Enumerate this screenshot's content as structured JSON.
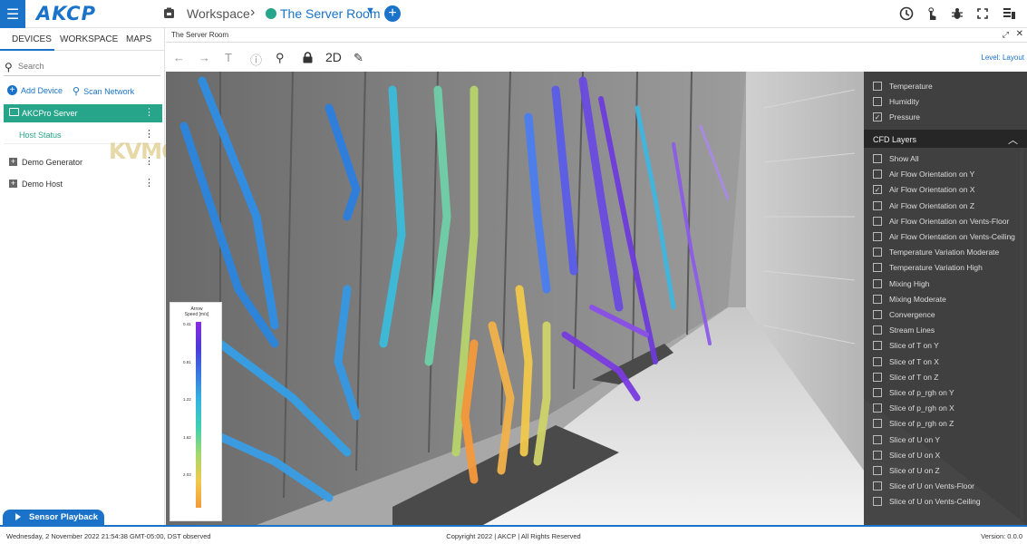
{
  "app": {
    "logo": "AKCP"
  },
  "breadcrumb": {
    "workspace": "Workspace",
    "room": "The Server Room"
  },
  "sidebar": {
    "tabs": [
      "DEVICES",
      "WORKSPACE",
      "MAPS"
    ],
    "search_placeholder": "Search",
    "actions": {
      "add_device": "Add Device",
      "scan_network": "Scan Network"
    },
    "server": "AKCPro Server",
    "host_status": "Host Status",
    "devices": [
      "Demo Generator",
      "Demo Host"
    ],
    "watermark": "KVMGalore"
  },
  "panel": {
    "title": "The Server Room",
    "toolbar": {
      "mode_2d": "2D"
    },
    "level": "Level: Layout"
  },
  "legend": {
    "title_line1": "Arrow",
    "title_line2": "Speed [m/s]",
    "ticks": [
      "0.41",
      "0.81",
      "1.22",
      "1.62",
      "2.03"
    ]
  },
  "layers": {
    "top_items": [
      {
        "label": "Temperature",
        "checked": false
      },
      {
        "label": "Humidity",
        "checked": false
      },
      {
        "label": "Pressure",
        "checked": true
      }
    ],
    "cfd_title": "CFD Layers",
    "cfd_items": [
      {
        "label": "Show All",
        "checked": false
      },
      {
        "label": "Air Flow Orientation on Y",
        "checked": false
      },
      {
        "label": "Air Flow Orientation on X",
        "checked": true
      },
      {
        "label": "Air Flow Orientation on Z",
        "checked": false
      },
      {
        "label": "Air Flow Orientation on Vents-Floor",
        "checked": false
      },
      {
        "label": "Air Flow Orientation on Vents-Ceiling",
        "checked": false
      },
      {
        "label": "Temperature Variation Moderate",
        "checked": false
      },
      {
        "label": "Temperature Variation High",
        "checked": false
      },
      {
        "label": "Mixing High",
        "checked": false
      },
      {
        "label": "Mixing Moderate",
        "checked": false
      },
      {
        "label": "Convergence",
        "checked": false
      },
      {
        "label": "Stream Lines",
        "checked": false
      },
      {
        "label": "Slice of T on Y",
        "checked": false
      },
      {
        "label": "Slice of T on X",
        "checked": false
      },
      {
        "label": "Slice of T on Z",
        "checked": false
      },
      {
        "label": "Slice of p_rgh on Y",
        "checked": false
      },
      {
        "label": "Slice of p_rgh on X",
        "checked": false
      },
      {
        "label": "Slice of p_rgh on Z",
        "checked": false
      },
      {
        "label": "Slice of U on Y",
        "checked": false
      },
      {
        "label": "Slice of U on X",
        "checked": false
      },
      {
        "label": "Slice of U on Z",
        "checked": false
      },
      {
        "label": "Slice of U on Vents-Floor",
        "checked": false
      },
      {
        "label": "Slice of U on Vents-Ceiling",
        "checked": false
      }
    ]
  },
  "playback": {
    "label": "Sensor Playback"
  },
  "footer": {
    "datetime": "Wednesday, 2 November 2022 21:54:38 GMT-05:00, DST observed",
    "copyright": "Copyright 2022 | AKCP | All Rights Reserved",
    "version": "Version: 0.0.0"
  }
}
